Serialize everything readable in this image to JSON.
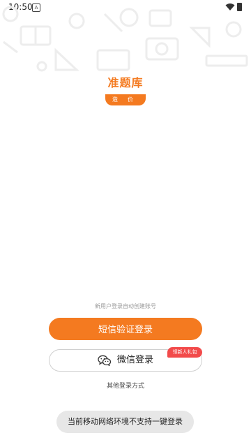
{
  "status_bar": {
    "time": "10:50",
    "notification_letter": "A"
  },
  "brand": {
    "name": "准题库",
    "badge": "造价"
  },
  "login": {
    "hint": "新用户登录自动创建账号",
    "sms_button": "短信验证登录",
    "wechat_button": "微信登录",
    "gift_badge": "领新人礼包",
    "other_methods": "其他登录方式"
  },
  "toast": {
    "message": "当前移动网络环境不支持一键登录"
  },
  "colors": {
    "accent": "#f47a20",
    "badge_red": "#f24a4a",
    "toast_bg": "#e7e7e7"
  },
  "icons": [
    "wifi-icon",
    "battery-icon",
    "wechat-icon"
  ]
}
